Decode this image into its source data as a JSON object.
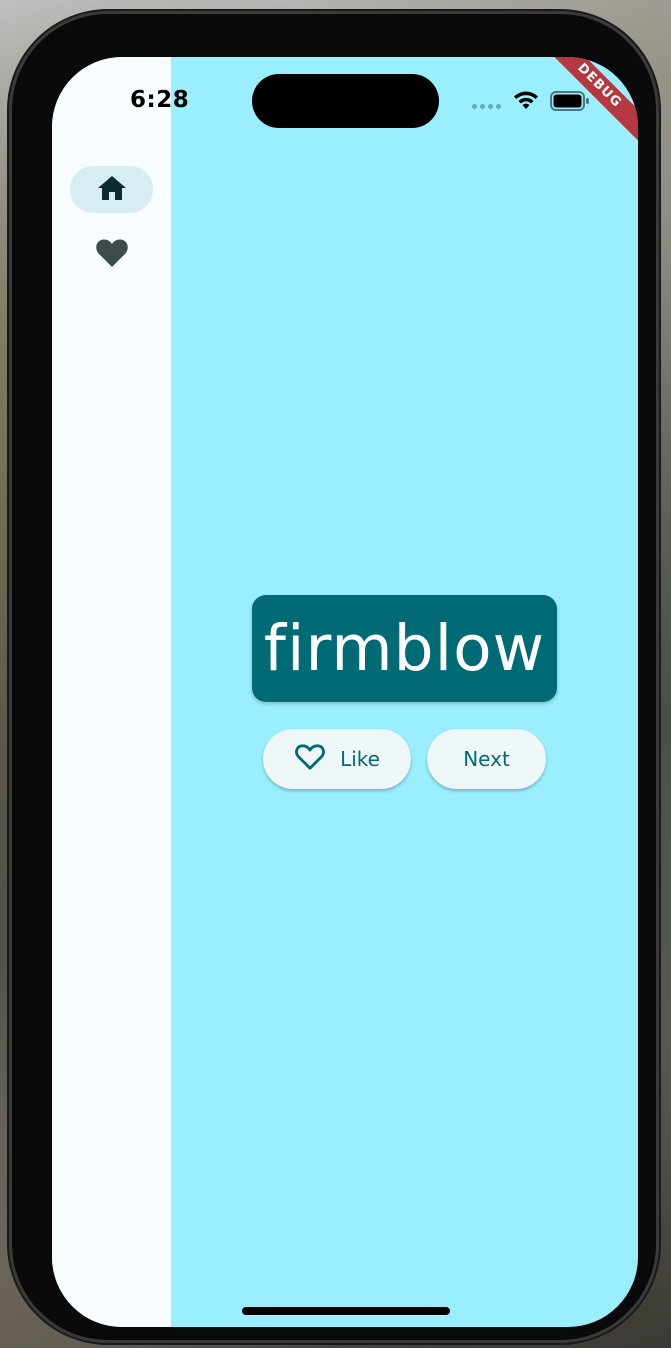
{
  "status_bar": {
    "time": "6:28",
    "debug_label": "DEBUG"
  },
  "nav_rail": {
    "items": [
      {
        "icon": "home-icon",
        "selected": true
      },
      {
        "icon": "heart-icon",
        "selected": false
      }
    ]
  },
  "main": {
    "word": "firmblow",
    "like_label": "Like",
    "next_label": "Next"
  },
  "colors": {
    "background": "#99efff",
    "rail": "#f7fdff",
    "card": "#006b75",
    "button_bg": "#eef6f8",
    "accent": "#006b75"
  }
}
